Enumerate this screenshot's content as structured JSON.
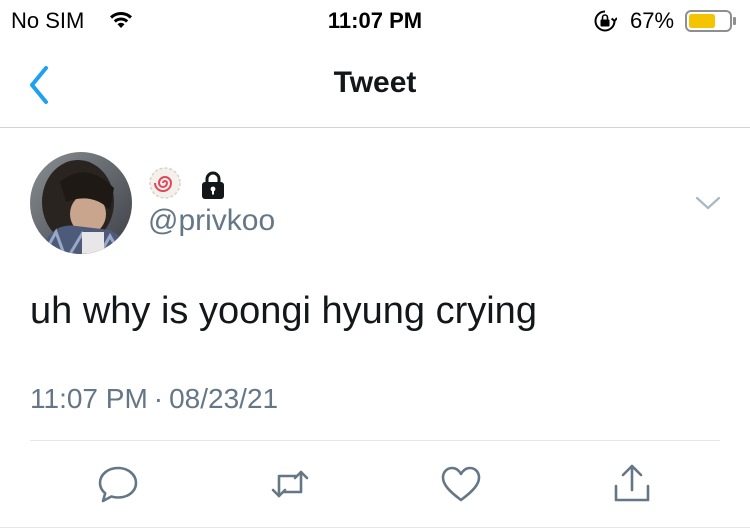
{
  "status_bar": {
    "carrier": "No SIM",
    "time": "11:07 PM",
    "battery_percent": "67%",
    "battery_level": 0.67,
    "battery_color": "#f5c400"
  },
  "nav": {
    "title": "Tweet",
    "back_icon": "chevron-left-icon",
    "accent_color": "#1da1f2"
  },
  "tweet": {
    "display_name_icons": [
      "fishcake-emoji-icon",
      "lock-icon"
    ],
    "handle": "@privkoo",
    "text": "uh why is yoongi hyung crying",
    "time": "11:07 PM",
    "separator": "·",
    "date": "08/23/21"
  },
  "actions": [
    "reply-icon",
    "retweet-icon",
    "like-icon",
    "share-icon"
  ]
}
